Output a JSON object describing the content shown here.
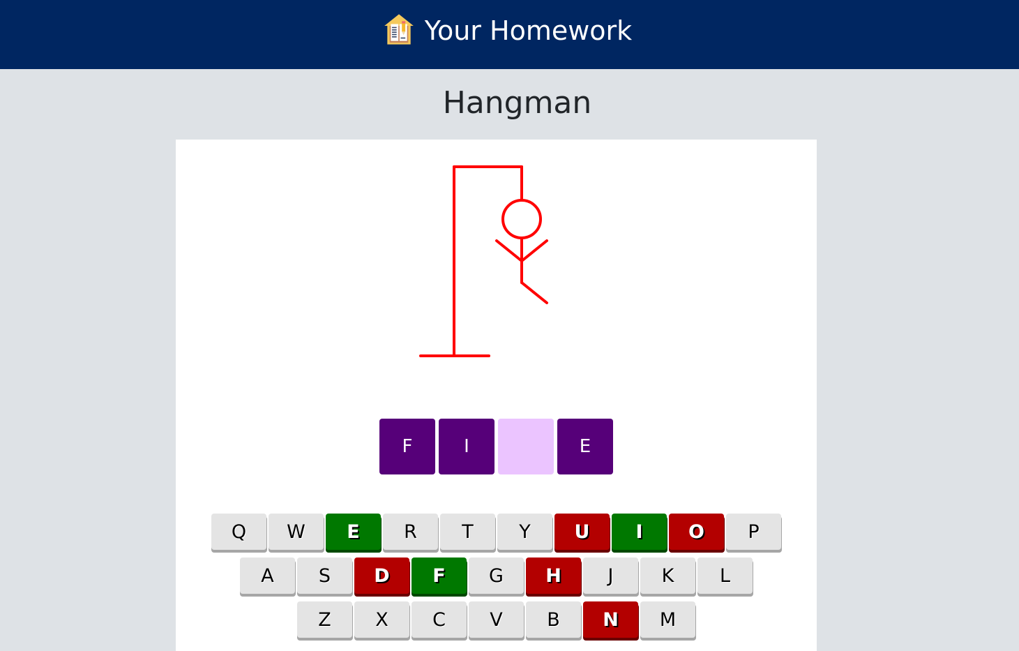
{
  "header": {
    "brand_icon": "homework-house-book-icon",
    "title": "Your Homework"
  },
  "page": {
    "title": "Hangman"
  },
  "game": {
    "drawing_color": "#ff0000",
    "wrong_guesses": 5,
    "visible_parts": [
      "gallows-base",
      "gallows-pole",
      "gallows-beam",
      "rope",
      "head",
      "body",
      "left-arm",
      "right-arm",
      "right-leg"
    ],
    "word_tiles": [
      {
        "letter": "F",
        "revealed": true
      },
      {
        "letter": "I",
        "revealed": true
      },
      {
        "letter": "",
        "revealed": false
      },
      {
        "letter": "E",
        "revealed": true
      }
    ],
    "colors": {
      "tile_revealed": "#560079",
      "tile_hidden": "#ebc4ff",
      "key_default": "#e4e4e4",
      "key_correct": "#007800",
      "key_wrong": "#b30000"
    }
  },
  "keyboard": {
    "rows": [
      [
        {
          "letter": "Q",
          "state": "unused"
        },
        {
          "letter": "W",
          "state": "unused"
        },
        {
          "letter": "E",
          "state": "correct"
        },
        {
          "letter": "R",
          "state": "unused"
        },
        {
          "letter": "T",
          "state": "unused"
        },
        {
          "letter": "Y",
          "state": "unused"
        },
        {
          "letter": "U",
          "state": "wrong"
        },
        {
          "letter": "I",
          "state": "correct"
        },
        {
          "letter": "O",
          "state": "wrong"
        },
        {
          "letter": "P",
          "state": "unused"
        }
      ],
      [
        {
          "letter": "A",
          "state": "unused"
        },
        {
          "letter": "S",
          "state": "unused"
        },
        {
          "letter": "D",
          "state": "wrong"
        },
        {
          "letter": "F",
          "state": "correct"
        },
        {
          "letter": "G",
          "state": "unused"
        },
        {
          "letter": "H",
          "state": "wrong"
        },
        {
          "letter": "J",
          "state": "unused"
        },
        {
          "letter": "K",
          "state": "unused"
        },
        {
          "letter": "L",
          "state": "unused"
        }
      ],
      [
        {
          "letter": "Z",
          "state": "unused"
        },
        {
          "letter": "X",
          "state": "unused"
        },
        {
          "letter": "C",
          "state": "unused"
        },
        {
          "letter": "V",
          "state": "unused"
        },
        {
          "letter": "B",
          "state": "unused"
        },
        {
          "letter": "N",
          "state": "wrong"
        },
        {
          "letter": "M",
          "state": "unused"
        }
      ]
    ]
  }
}
